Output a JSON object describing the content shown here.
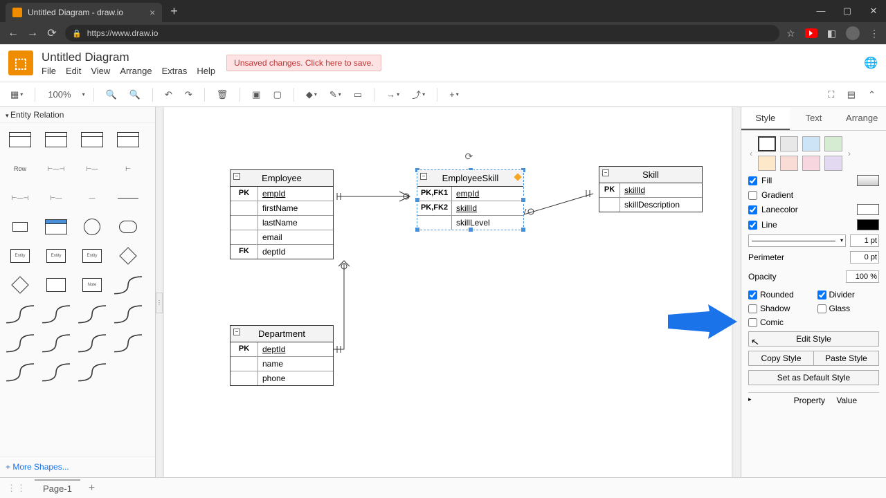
{
  "browser": {
    "tab_title": "Untitled Diagram - draw.io",
    "url": "https://www.draw.io"
  },
  "header": {
    "doc_title": "Untitled Diagram",
    "menus": [
      "File",
      "Edit",
      "View",
      "Arrange",
      "Extras",
      "Help"
    ],
    "save_warning": "Unsaved changes. Click here to save."
  },
  "toolbar": {
    "zoom": "100%"
  },
  "left_panel": {
    "section": "Entity Relation",
    "row_label": "Row",
    "more_shapes": "+ More Shapes..."
  },
  "canvas": {
    "entities": {
      "employee": {
        "title": "Employee",
        "rows": [
          {
            "key": "PK",
            "field": "empId",
            "u": true
          },
          {
            "key": "",
            "field": "firstName"
          },
          {
            "key": "",
            "field": "lastName"
          },
          {
            "key": "",
            "field": "email"
          },
          {
            "key": "FK",
            "field": "deptId"
          }
        ]
      },
      "employee_skill": {
        "title": "EmployeeSkill",
        "rows": [
          {
            "key": "PK,FK1",
            "field": "empId",
            "u": true
          },
          {
            "key": "PK,FK2",
            "field": "skillId",
            "u": true
          },
          {
            "key": "",
            "field": "skillLevel"
          }
        ]
      },
      "skill": {
        "title": "Skill",
        "rows": [
          {
            "key": "PK",
            "field": "skillId",
            "u": true
          },
          {
            "key": "",
            "field": "skillDescription"
          }
        ]
      },
      "department": {
        "title": "Department",
        "rows": [
          {
            "key": "PK",
            "field": "deptId",
            "u": true
          },
          {
            "key": "",
            "field": "name"
          },
          {
            "key": "",
            "field": "phone"
          }
        ]
      }
    }
  },
  "right_panel": {
    "tabs": [
      "Style",
      "Text",
      "Arrange"
    ],
    "active_tab": 0,
    "swatches_row1": [
      "#ffffff",
      "#e8e8e8",
      "#cde4f7",
      "#d6ecd2"
    ],
    "swatches_row2": [
      "#fde9c9",
      "#f9dcd6",
      "#f7d6e0",
      "#e3daf2"
    ],
    "fill": {
      "label": "Fill",
      "checked": true,
      "color": "#ffffff"
    },
    "gradient": {
      "label": "Gradient",
      "checked": false
    },
    "lanecolor": {
      "label": "Lanecolor",
      "checked": true,
      "color": "#ffffff"
    },
    "line": {
      "label": "Line",
      "checked": true,
      "color": "#000000",
      "width": "1 pt"
    },
    "perimeter": {
      "label": "Perimeter",
      "value": "0 pt"
    },
    "opacity": {
      "label": "Opacity",
      "value": "100 %"
    },
    "rounded": {
      "label": "Rounded",
      "checked": true
    },
    "divider": {
      "label": "Divider",
      "checked": true
    },
    "shadow": {
      "label": "Shadow",
      "checked": false
    },
    "glass": {
      "label": "Glass",
      "checked": false
    },
    "comic": {
      "label": "Comic",
      "checked": false
    },
    "edit_style": "Edit Style",
    "copy_style": "Copy Style",
    "paste_style": "Paste Style",
    "default_style": "Set as Default Style",
    "prop_header": {
      "prop": "Property",
      "val": "Value"
    }
  },
  "footer": {
    "page": "Page-1"
  }
}
